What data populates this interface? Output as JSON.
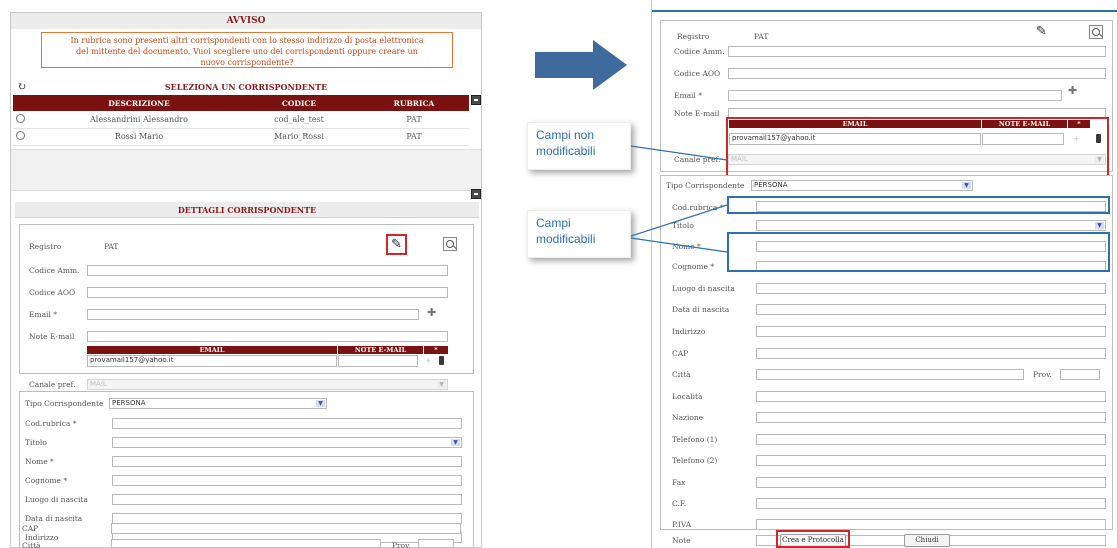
{
  "left_panel": {
    "avviso_title": "AVVISO",
    "avviso_line1": "In rubrica sono presenti altri corrispondenti con lo stesso indirizzo di posta elettronica",
    "avviso_line2": "del mittente del documento. Vuoi scegliere uno dei corrispondenti oppure creare un",
    "avviso_line3": "nuovo corrispondente?",
    "select_title": "SELEZIONA UN CORRISPONDENTE",
    "columns": [
      "DESCRIZIONE",
      "CODICE",
      "RUBRICA"
    ],
    "rows": [
      {
        "descrizione": "Alessandrini Alessandro",
        "codice": "cod_ale_test",
        "rubrica": "PAT"
      },
      {
        "descrizione": "Rossi Mario",
        "codice": "Mario_Rossi",
        "rubrica": "PAT"
      }
    ],
    "details_title": "DETTAGLI CORRISPONDENTE"
  },
  "form": {
    "registro_label": "Registro",
    "registro_value": "PAT",
    "codice_amm_label": "Codice Amm.",
    "codice_aoo_label": "Codice AOO",
    "email_label": "Email *",
    "note_email_label": "Note E-mail",
    "email_col": "EMAIL",
    "note_col": "NOTE E-MAIL",
    "star_col": "*",
    "email_value": "provamail157@yahoo.it",
    "canale_label": "Canale pref.",
    "canale_value": "MAIL",
    "tipo_label": "Tipo Corrispondente",
    "tipo_value": "PERSONA",
    "cod_rubrica_label": "Cod.rubrica *",
    "titolo_label": "Titolo",
    "nome_label": "Nome *",
    "cognome_label": "Cognome *",
    "luogo_label": "Luogo di nascita",
    "data_label": "Data di nascita",
    "indirizzo_label": "Indirizzo",
    "cap_label": "CAP",
    "citta_label": "Città",
    "prov_label": "Prov.",
    "localita_label": "Località",
    "nazione_label": "Nazione",
    "tel1_label": "Telefono (1)",
    "tel2_label": "Telefono (2)",
    "fax_label": "Fax",
    "cf_label": "C.F.",
    "piva_label": "P.IVA",
    "note_label": "Note",
    "crea_button": "Crea e Protocolla",
    "chiudi_button": "Chiudi"
  },
  "callouts": {
    "non_mod_line1": "Campi non",
    "non_mod_line2": "modificabili",
    "mod_line1": "Campi",
    "mod_line2": "modificabili"
  },
  "colors": {
    "header_red": "#7a1212",
    "highlight_red": "#d3262a",
    "highlight_blue": "#2d6fb0",
    "arrow_blue": "#3e6a9e"
  },
  "icons": [
    "refresh-icon",
    "pencil-icon",
    "magnifier-icon",
    "plus-icon",
    "trash-icon",
    "dropdown-arrow-icon",
    "minimize-icon"
  ]
}
